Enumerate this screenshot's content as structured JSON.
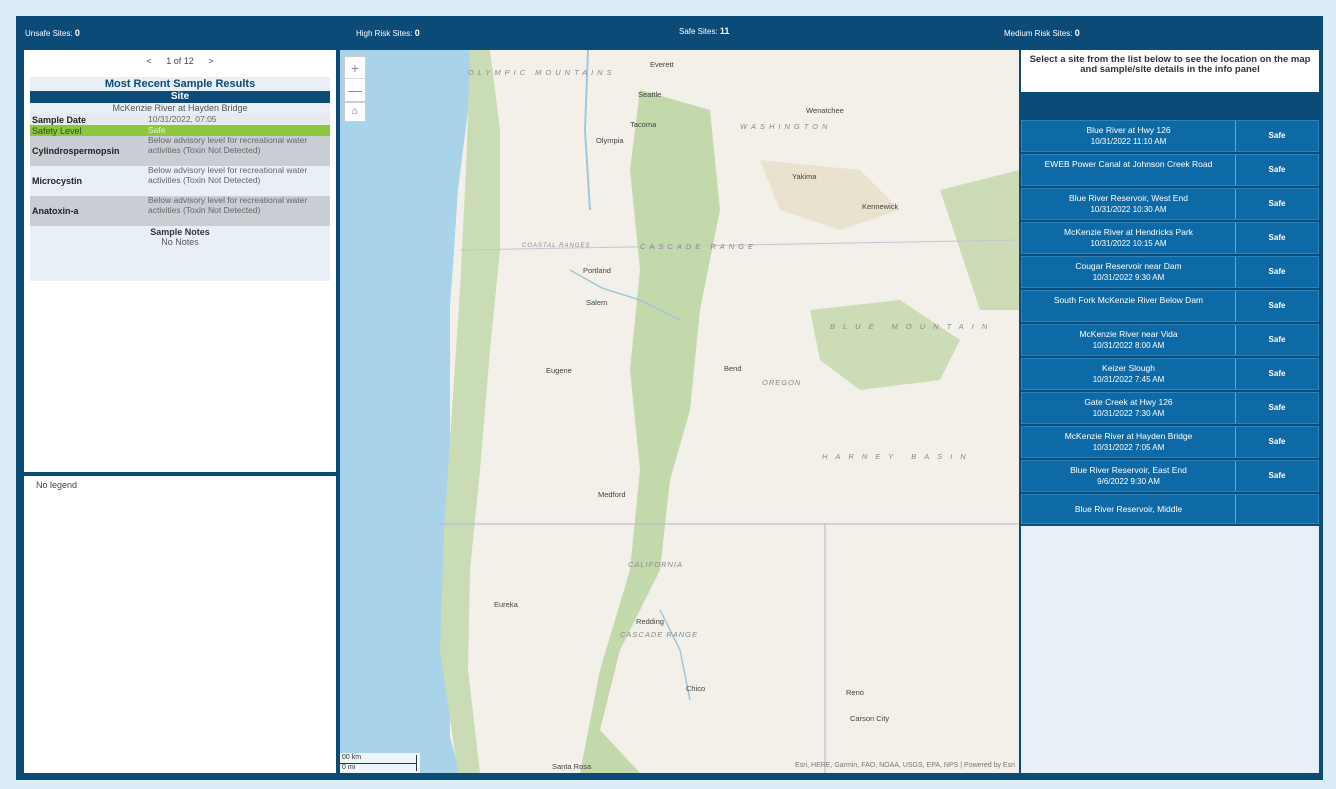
{
  "stats": {
    "unsafe": {
      "label": "Unsafe Sites:",
      "value": "0"
    },
    "high": {
      "label": "High Risk Sites:",
      "value": "0"
    },
    "safe": {
      "label": "Safe Sites:",
      "value": "11"
    },
    "medium": {
      "label": "Medium Risk Sites:",
      "value": "0"
    }
  },
  "pager": {
    "prev": "<",
    "text": "1 of 12",
    "next": ">"
  },
  "sample": {
    "title": "Most Recent Sample Results",
    "site_header": "Site",
    "site_name": "McKenzie River at Hayden Bridge",
    "rows": [
      {
        "label": "Sample Date",
        "value": "10/31/2022, 07:05"
      },
      {
        "label": "Safety Level",
        "value": "Safe"
      },
      {
        "label": "Cylindrospermopsin",
        "value": "Below advisory level for recreational water activities (Toxin Not Detected)"
      },
      {
        "label": "Microcystin",
        "value": "Below advisory level for recreational water activities (Toxin Not Detected)"
      },
      {
        "label": "Anatoxin-a",
        "value": "Below advisory level for recreational water activities (Toxin Not Detected)"
      }
    ],
    "notes_title": "Sample Notes",
    "notes_text": "No Notes",
    "safety_color": "#8dc63f"
  },
  "legend": {
    "text": "No legend"
  },
  "map": {
    "labels": {
      "olympic": "OLYMPIC MOUNTAINS",
      "everett": "Everett",
      "seattle": "Seattle",
      "tacoma": "Tacoma",
      "olympia": "Olympia",
      "wenatchee": "Wenatchee",
      "washington": "WASHINGTON",
      "yakima": "Yakima",
      "kennewick": "Kennewick",
      "coastal": "COASTAL RANGES",
      "cascade": "CASCADE RANGE",
      "portland": "Portland",
      "salem": "Salem",
      "blue_mtn": "BLUE MOUNTAIN",
      "eugene": "Eugene",
      "bend": "Bend",
      "oregon": "OREGON",
      "harney": "HARNEY BASIN",
      "medford": "Medford",
      "california": "CALIFORNIA",
      "eureka": "Eureka",
      "redding": "Redding",
      "cascade2": "CASCADE RANGE",
      "chico": "Chico",
      "reno": "Reno",
      "carson": "Carson City",
      "santa_rosa": "Santa Rosa"
    },
    "zoom_in": "+",
    "zoom_out": "—",
    "home_icon": "⌂",
    "scale_km": "00 km",
    "scale_mi": "0 mi",
    "attribution": "Esri, HERE, Garmin, FAO, NOAA, USGS, EPA, NPS | Powered by Esri"
  },
  "instruction": "Select a site from the list below to see the location on the map and sample/site details in the info panel",
  "sites": [
    {
      "name": "Blue River at Hwy 126",
      "date": "10/31/2022 11:10 AM",
      "level": "Safe"
    },
    {
      "name": "EWEB Power Canal at Johnson Creek Road",
      "date": "",
      "level": "Safe"
    },
    {
      "name": "Blue River Reservoir, West End",
      "date": "10/31/2022 10:30 AM",
      "level": "Safe"
    },
    {
      "name": "McKenzie River at Hendricks Park",
      "date": "10/31/2022 10:15 AM",
      "level": "Safe"
    },
    {
      "name": "Cougar Reservoir near Dam",
      "date": "10/31/2022 9:30 AM",
      "level": "Safe"
    },
    {
      "name": "South Fork McKenzie River Below Dam",
      "date": "",
      "level": "Safe"
    },
    {
      "name": "McKenzie River near Vida",
      "date": "10/31/2022 8:00 AM",
      "level": "Safe"
    },
    {
      "name": "Keizer Slough",
      "date": "10/31/2022 7:45 AM",
      "level": "Safe"
    },
    {
      "name": "Gate Creek at Hwy 126",
      "date": "10/31/2022 7:30 AM",
      "level": "Safe"
    },
    {
      "name": "McKenzie River at Hayden Bridge",
      "date": "10/31/2022 7:05 AM",
      "level": "Safe"
    },
    {
      "name": "Blue River Reservoir, East End",
      "date": "9/6/2022 9:30 AM",
      "level": "Safe"
    },
    {
      "name": "Blue River Reservoir, Middle",
      "date": "",
      "level": ""
    }
  ],
  "colors": {
    "frame": "#0c4a78",
    "row": "#0e6aa6",
    "safe": "#8dc63f"
  }
}
